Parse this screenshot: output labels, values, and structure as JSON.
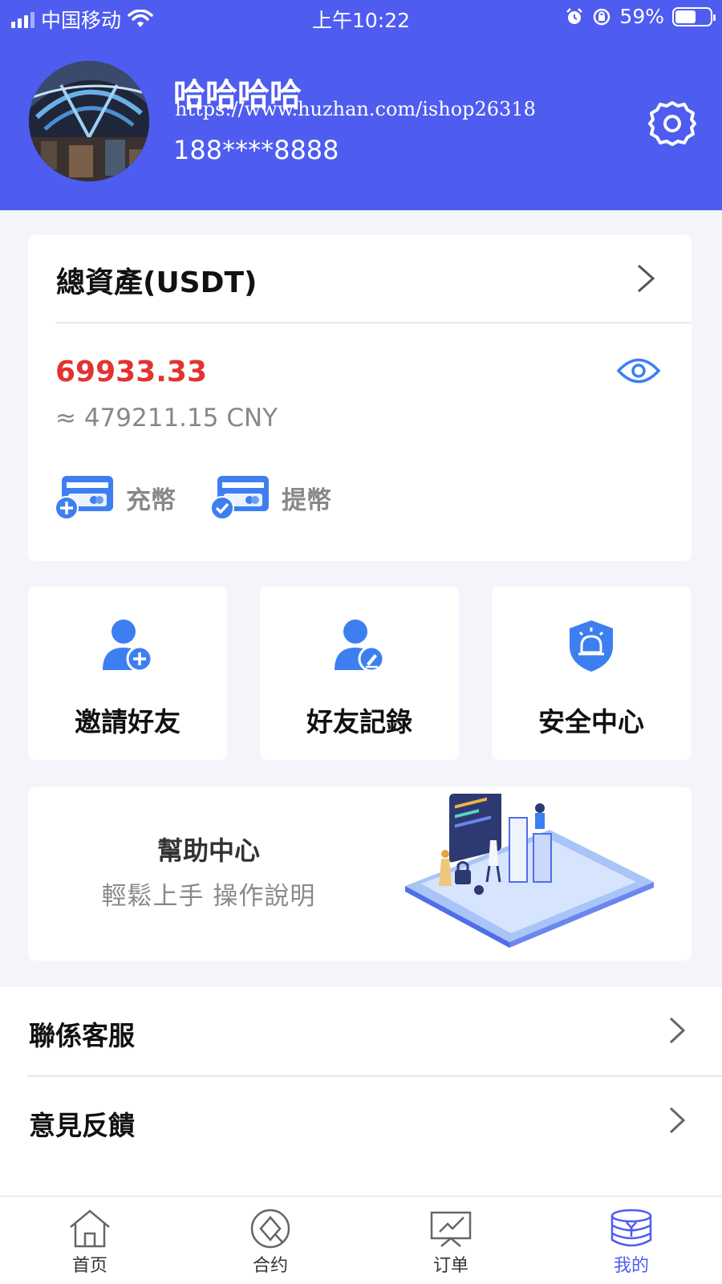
{
  "status_bar": {
    "carrier": "中国移动",
    "time": "上午10:22",
    "battery": "59%",
    "battery_level": 0.59
  },
  "profile": {
    "username": "哈哈哈哈",
    "watermark": "https://www.huzhan.com/ishop26318",
    "phone": "188****8888"
  },
  "assets": {
    "title": "總資產(USDT)",
    "amount": "69933.33",
    "cny": "≈ 479211.15 CNY",
    "deposit_label": "充幣",
    "withdraw_label": "提幣"
  },
  "features": [
    {
      "label": "邀請好友",
      "icon": "add-user-icon"
    },
    {
      "label": "好友記錄",
      "icon": "user-edit-icon"
    },
    {
      "label": "安全中心",
      "icon": "security-alarm-icon"
    }
  ],
  "help": {
    "title": "幫助中心",
    "subtitle": "輕鬆上手  操作說明"
  },
  "menu": [
    {
      "label": "聯係客服"
    },
    {
      "label": "意見反饋"
    }
  ],
  "tabs": [
    {
      "label": "首页",
      "icon": "home-icon"
    },
    {
      "label": "合约",
      "icon": "contract-icon"
    },
    {
      "label": "订单",
      "icon": "order-icon"
    },
    {
      "label": "我的",
      "icon": "coins-icon",
      "active": true
    }
  ],
  "colors": {
    "brand": "#4f5cf0",
    "amount": "#e2332f",
    "icon_blue": "#3d7ff0"
  }
}
